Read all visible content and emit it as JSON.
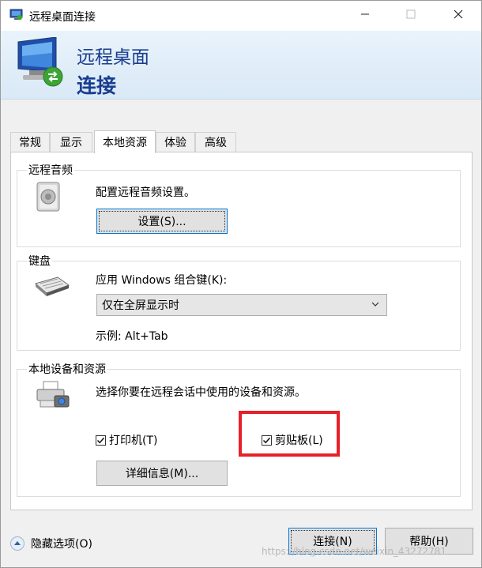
{
  "window": {
    "title": "远程桌面连接",
    "controls": {
      "minimize": "minimize-icon",
      "maximize": "maximize-icon",
      "close": "close-icon"
    }
  },
  "banner": {
    "line1": "远程桌面",
    "line2": "连接"
  },
  "tabs": [
    {
      "label": "常规"
    },
    {
      "label": "显示"
    },
    {
      "label": "本地资源",
      "active": true
    },
    {
      "label": "体验"
    },
    {
      "label": "高级"
    }
  ],
  "audio": {
    "legend": "远程音频",
    "description": "配置远程音频设置。",
    "settings_button": "设置(S)..."
  },
  "keyboard": {
    "legend": "键盘",
    "label": "应用 Windows 组合键(K):",
    "selected": "仅在全屏显示时",
    "example": "示例: Alt+Tab"
  },
  "devices": {
    "legend": "本地设备和资源",
    "description": "选择你要在远程会话中使用的设备和资源。",
    "printer": {
      "label": "打印机(T)",
      "checked": true
    },
    "clipboard": {
      "label": "剪贴板(L)",
      "checked": true
    },
    "details_button": "详细信息(M)..."
  },
  "footer": {
    "hide_options": "隐藏选项(O)",
    "connect_button": "连接(N)",
    "help_button": "帮助(H)"
  },
  "watermark": "https://blog.csdn.net/weixin_43272781",
  "colors": {
    "highlight_box": "#e8202a",
    "banner_text": "#1a3d8f",
    "accent": "#0078d7"
  }
}
